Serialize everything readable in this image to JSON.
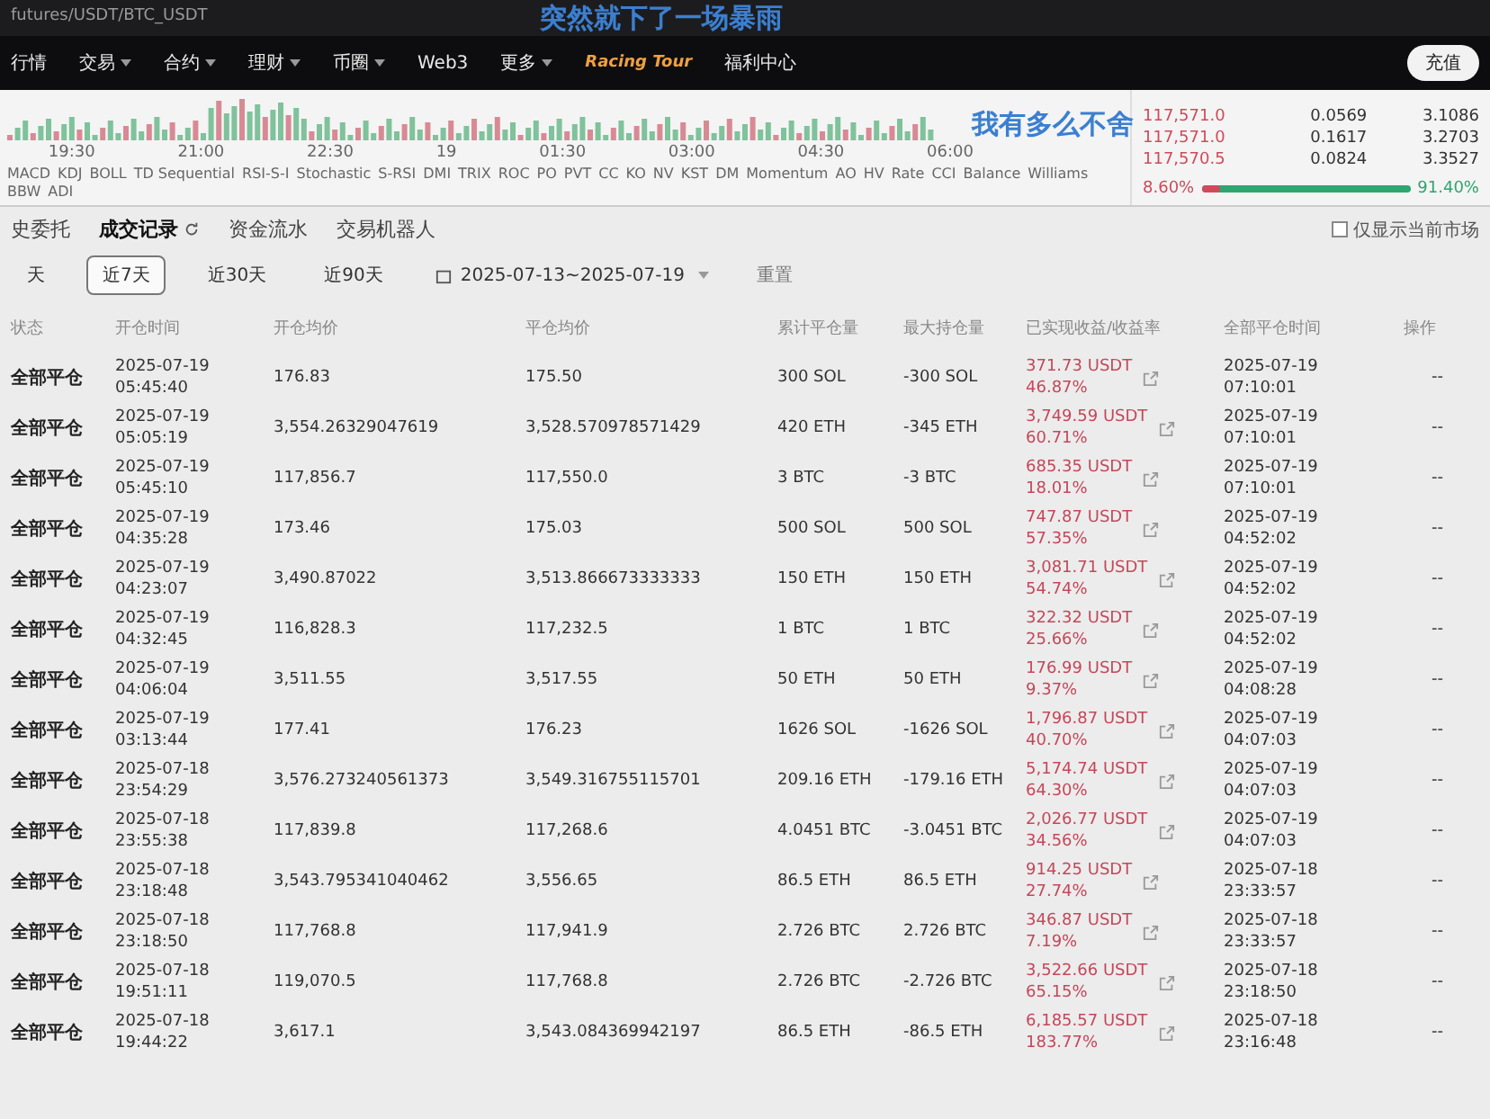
{
  "address_bar": {
    "url": "futures/USDT/BTC_USDT"
  },
  "nav": {
    "items": [
      {
        "label": "行情",
        "caret": false
      },
      {
        "label": "交易",
        "caret": true
      },
      {
        "label": "合约",
        "caret": true
      },
      {
        "label": "理财",
        "caret": true
      },
      {
        "label": "币圈",
        "caret": true
      },
      {
        "label": "Web3",
        "caret": false
      },
      {
        "label": "更多",
        "caret": true
      }
    ],
    "promo": "Racing Tour",
    "welfare": "福利中心",
    "deposit": "充值"
  },
  "captions": [
    "突然就下了一场暴雨",
    "我有多么不舍"
  ],
  "chart": {
    "times": [
      "19:30",
      "21:00",
      "22:30",
      "19",
      "01:30",
      "03:00",
      "04:30",
      "06:00"
    ],
    "indicators": [
      "MACD",
      "KDJ",
      "BOLL",
      "TD Sequential",
      "RSI-S-I",
      "Stochastic",
      "S-RSI",
      "DMI",
      "TRIX",
      "ROC",
      "PO",
      "PVT",
      "CC",
      "KO",
      "NV",
      "KST",
      "DM",
      "Momentum",
      "AO",
      "HV",
      "Rate",
      "CCI",
      "Balance",
      "Williams",
      "BBW",
      "ADI"
    ]
  },
  "order_book": {
    "rows": [
      {
        "price": "117,571.0",
        "amount": "0.0569",
        "total": "3.1086"
      },
      {
        "price": "117,571.0",
        "amount": "0.1617",
        "total": "3.2703"
      },
      {
        "price": "117,570.5",
        "amount": "0.0824",
        "total": "3.3527"
      }
    ],
    "sell_share": "8.60%",
    "buy_share": "91.40%",
    "level": 0.086
  },
  "tabs": [
    {
      "label": "史委托",
      "selected": false,
      "refresh": false
    },
    {
      "label": "成交记录",
      "selected": true,
      "refresh": true
    },
    {
      "label": "资金流水",
      "selected": false,
      "refresh": false
    },
    {
      "label": "交易机器人",
      "selected": false,
      "refresh": false
    }
  ],
  "current_market_only": {
    "label": "仅显示当前市场",
    "checked": false
  },
  "periods": [
    {
      "label": "天",
      "selected": false
    },
    {
      "label": "近7天",
      "selected": true
    },
    {
      "label": "近30天",
      "selected": false
    },
    {
      "label": "近90天",
      "selected": false
    }
  ],
  "date_range": "2025-07-13~2025-07-19",
  "reset": "重置",
  "table": {
    "columns": [
      "状态",
      "开仓时间",
      "开仓均价",
      "平仓均价",
      "累计平仓量",
      "最大持仓量",
      "已实现收益/收益率",
      "全部平仓时间",
      "操作"
    ],
    "rows": [
      {
        "status": "全部平仓",
        "open_date": "2025-07-19",
        "open_time": "05:45:40",
        "open_price": "176.83",
        "close_price": "175.50",
        "closed_qty": "300 SOL",
        "max_qty": "-300 SOL",
        "pnl": "371.73 USDT",
        "rate": "46.87%",
        "close_date": "2025-07-19",
        "close_time": "07:10:01",
        "action": "--"
      },
      {
        "status": "全部平仓",
        "open_date": "2025-07-19",
        "open_time": "05:05:19",
        "open_price": "3,554.26329047619",
        "close_price": "3,528.570978571429",
        "closed_qty": "420 ETH",
        "max_qty": "-345 ETH",
        "pnl": "3,749.59 USDT",
        "rate": "60.71%",
        "close_date": "2025-07-19",
        "close_time": "07:10:01",
        "action": "--"
      },
      {
        "status": "全部平仓",
        "open_date": "2025-07-19",
        "open_time": "05:45:10",
        "open_price": "117,856.7",
        "close_price": "117,550.0",
        "closed_qty": "3 BTC",
        "max_qty": "-3 BTC",
        "pnl": "685.35 USDT",
        "rate": "18.01%",
        "close_date": "2025-07-19",
        "close_time": "07:10:01",
        "action": "--"
      },
      {
        "status": "全部平仓",
        "open_date": "2025-07-19",
        "open_time": "04:35:28",
        "open_price": "173.46",
        "close_price": "175.03",
        "closed_qty": "500 SOL",
        "max_qty": "500 SOL",
        "pnl": "747.87 USDT",
        "rate": "57.35%",
        "close_date": "2025-07-19",
        "close_time": "04:52:02",
        "action": "--"
      },
      {
        "status": "全部平仓",
        "open_date": "2025-07-19",
        "open_time": "04:23:07",
        "open_price": "3,490.87022",
        "close_price": "3,513.866673333333",
        "closed_qty": "150 ETH",
        "max_qty": "150 ETH",
        "pnl": "3,081.71 USDT",
        "rate": "54.74%",
        "close_date": "2025-07-19",
        "close_time": "04:52:02",
        "action": "--"
      },
      {
        "status": "全部平仓",
        "open_date": "2025-07-19",
        "open_time": "04:32:45",
        "open_price": "116,828.3",
        "close_price": "117,232.5",
        "closed_qty": "1 BTC",
        "max_qty": "1 BTC",
        "pnl": "322.32 USDT",
        "rate": "25.66%",
        "close_date": "2025-07-19",
        "close_time": "04:52:02",
        "action": "--"
      },
      {
        "status": "全部平仓",
        "open_date": "2025-07-19",
        "open_time": "04:06:04",
        "open_price": "3,511.55",
        "close_price": "3,517.55",
        "closed_qty": "50 ETH",
        "max_qty": "50 ETH",
        "pnl": "176.99 USDT",
        "rate": "9.37%",
        "close_date": "2025-07-19",
        "close_time": "04:08:28",
        "action": "--"
      },
      {
        "status": "全部平仓",
        "open_date": "2025-07-19",
        "open_time": "03:13:44",
        "open_price": "177.41",
        "close_price": "176.23",
        "closed_qty": "1626 SOL",
        "max_qty": "-1626 SOL",
        "pnl": "1,796.87 USDT",
        "rate": "40.70%",
        "close_date": "2025-07-19",
        "close_time": "04:07:03",
        "action": "--"
      },
      {
        "status": "全部平仓",
        "open_date": "2025-07-18",
        "open_time": "23:54:29",
        "open_price": "3,576.273240561373",
        "close_price": "3,549.316755115701",
        "closed_qty": "209.16 ETH",
        "max_qty": "-179.16 ETH",
        "pnl": "5,174.74 USDT",
        "rate": "64.30%",
        "close_date": "2025-07-19",
        "close_time": "04:07:03",
        "action": "--"
      },
      {
        "status": "全部平仓",
        "open_date": "2025-07-18",
        "open_time": "23:55:38",
        "open_price": "117,839.8",
        "close_price": "117,268.6",
        "closed_qty": "4.0451 BTC",
        "max_qty": "-3.0451 BTC",
        "pnl": "2,026.77 USDT",
        "rate": "34.56%",
        "close_date": "2025-07-19",
        "close_time": "04:07:03",
        "action": "--"
      },
      {
        "status": "全部平仓",
        "open_date": "2025-07-18",
        "open_time": "23:18:48",
        "open_price": "3,543.795341040462",
        "close_price": "3,556.65",
        "closed_qty": "86.5 ETH",
        "max_qty": "86.5 ETH",
        "pnl": "914.25 USDT",
        "rate": "27.74%",
        "close_date": "2025-07-18",
        "close_time": "23:33:57",
        "action": "--"
      },
      {
        "status": "全部平仓",
        "open_date": "2025-07-18",
        "open_time": "23:18:50",
        "open_price": "117,768.8",
        "close_price": "117,941.9",
        "closed_qty": "2.726 BTC",
        "max_qty": "2.726 BTC",
        "pnl": "346.87 USDT",
        "rate": "7.19%",
        "close_date": "2025-07-18",
        "close_time": "23:33:57",
        "action": "--"
      },
      {
        "status": "全部平仓",
        "open_date": "2025-07-18",
        "open_time": "19:51:11",
        "open_price": "119,070.5",
        "close_price": "117,768.8",
        "closed_qty": "2.726 BTC",
        "max_qty": "-2.726 BTC",
        "pnl": "3,522.66 USDT",
        "rate": "65.15%",
        "close_date": "2025-07-18",
        "close_time": "23:18:50",
        "action": "--"
      },
      {
        "status": "全部平仓",
        "open_date": "2025-07-18",
        "open_time": "19:44:22",
        "open_price": "3,617.1",
        "close_price": "3,543.084369942197",
        "closed_qty": "86.5 ETH",
        "max_qty": "-86.5 ETH",
        "pnl": "6,185.57 USDT",
        "rate": "183.77%",
        "close_date": "2025-07-18",
        "close_time": "23:16:48",
        "action": "--"
      }
    ]
  }
}
